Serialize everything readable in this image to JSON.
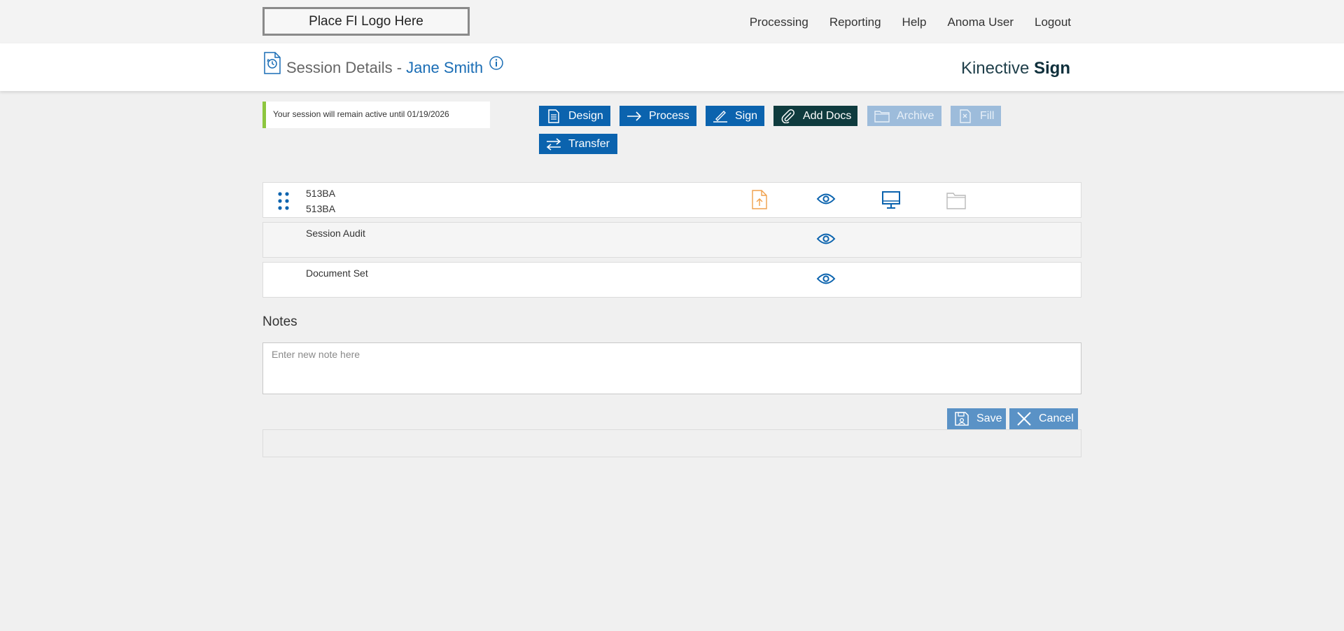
{
  "topbar": {
    "logo_text": "Place FI Logo Here",
    "nav": [
      "Processing",
      "Reporting",
      "Help",
      "Anoma User",
      "Logout"
    ]
  },
  "header": {
    "title": "Session Details -",
    "customer_name": "Jane Smith",
    "brand_regular": "Kinective",
    "brand_bold": "Sign"
  },
  "notice": {
    "text": "Your session will remain active until 01/19/2026",
    "accent_color": "#8dc63f"
  },
  "toolbar": {
    "design": "Design",
    "process": "Process",
    "sign": "Sign",
    "add_docs": "Add Docs",
    "archive": "Archive",
    "fill": "Fill",
    "transfer": "Transfer"
  },
  "documents": [
    {
      "line1": "513BA",
      "line2": "513BA"
    },
    {
      "line1": "Session Audit"
    },
    {
      "line1": "Document Set"
    }
  ],
  "notes": {
    "label": "Notes",
    "placeholder": "Enter new note here",
    "save": "Save",
    "cancel": "Cancel"
  },
  "colors": {
    "primary": "#0b63ae",
    "dark": "#0f3b3e",
    "disabled": "#9dbcdb",
    "upload": "#f0a04b"
  }
}
